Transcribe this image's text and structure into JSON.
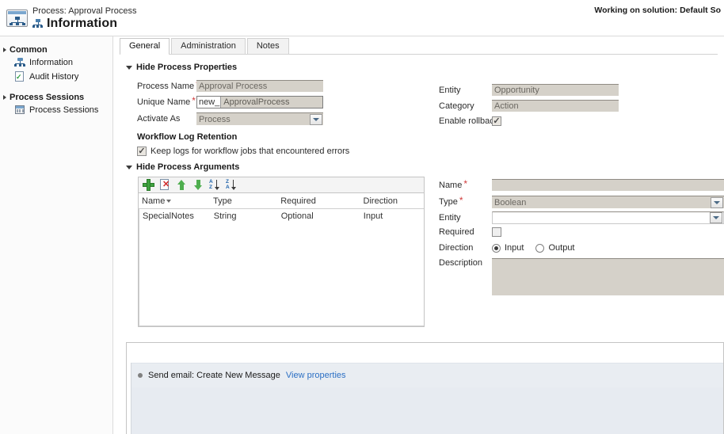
{
  "titlebar": {
    "subtitle": "Process: Approval Process",
    "title": "Information",
    "process_icon": "process-icon",
    "working_on": "Working on solution: Default So"
  },
  "sidebar": {
    "groups": [
      {
        "label": "Common",
        "items": [
          {
            "label": "Information",
            "icon": "information-icon"
          },
          {
            "label": "Audit History",
            "icon": "audit-history-icon"
          }
        ]
      },
      {
        "label": "Process Sessions",
        "items": [
          {
            "label": "Process Sessions",
            "icon": "process-sessions-icon"
          }
        ]
      }
    ]
  },
  "main": {
    "tabs": [
      {
        "label": "General",
        "active": true
      },
      {
        "label": "Administration",
        "active": false
      },
      {
        "label": "Notes",
        "active": false
      }
    ],
    "process_properties": {
      "section_label": "Hide Process Properties",
      "fields": {
        "process_name_label": "Process Name",
        "process_name_value": "Approval Process",
        "unique_name_label": "Unique Name",
        "unique_name_prefix": "new_",
        "unique_name_value": "ApprovalProcess",
        "activate_as_label": "Activate As",
        "activate_as_value": "Process",
        "entity_label": "Entity",
        "entity_value": "Opportunity",
        "category_label": "Category",
        "category_value": "Action",
        "enable_rollback_label": "Enable rollback",
        "enable_rollback_checked": true
      },
      "workflow_log_retention": {
        "heading": "Workflow Log Retention",
        "checkbox_label": "Keep logs for workflow jobs that encountered errors",
        "checked": true
      }
    },
    "process_arguments": {
      "section_label": "Hide Process Arguments",
      "toolbar": [
        {
          "name": "add-argument-button",
          "icon": "plus-icon"
        },
        {
          "name": "delete-argument-button",
          "icon": "delete-icon"
        },
        {
          "name": "move-up-button",
          "icon": "arrow-up-icon"
        },
        {
          "name": "move-down-button",
          "icon": "arrow-down-icon"
        },
        {
          "name": "sort-ascending-button",
          "icon": "sort-az-icon",
          "top": "A",
          "bottom": "Z"
        },
        {
          "name": "sort-descending-button",
          "icon": "sort-za-icon",
          "top": "Z",
          "bottom": "A"
        }
      ],
      "columns": [
        "Name",
        "Type",
        "Required",
        "Direction"
      ],
      "sorted_column": "Name",
      "rows": [
        {
          "name": "SpecialNotes",
          "type": "String",
          "required": "Optional",
          "direction": "Input"
        }
      ],
      "detail": {
        "name_label": "Name",
        "name_value": "",
        "type_label": "Type",
        "type_value": "Boolean",
        "entity_label": "Entity",
        "entity_value": "",
        "required_label": "Required",
        "required_checked": false,
        "direction_label": "Direction",
        "direction_input_label": "Input",
        "direction_output_label": "Output",
        "direction_selected": "Input",
        "description_label": "Description",
        "description_value": ""
      }
    },
    "steps": [
      {
        "bullet": "step-bullet",
        "text": "Send email: Create New Message",
        "link": "View properties"
      }
    ]
  }
}
